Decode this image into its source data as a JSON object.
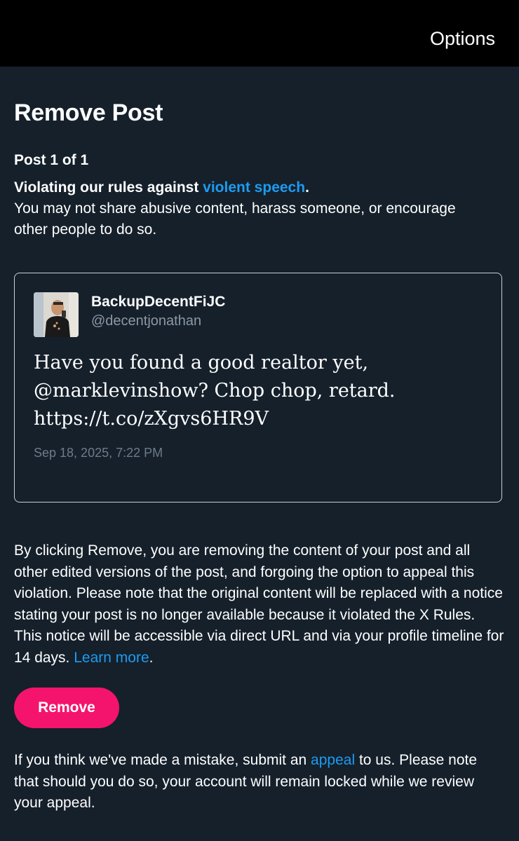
{
  "header": {
    "options_label": "Options"
  },
  "page": {
    "title": "Remove Post",
    "post_count": "Post 1 of 1"
  },
  "violation": {
    "headline_prefix": "Violating our rules against ",
    "rule_link": "violent speech",
    "headline_suffix": ".",
    "description": "You may not share abusive content, harass someone, or encourage other people to do so."
  },
  "tweet": {
    "display_name": "BackupDecentFiJC",
    "handle": "@decentjonathan",
    "text": "Have you found a good realtor yet, @marklevinshow? Chop chop, retard. https://t.co/zXgvs6HR9V",
    "date": "Sep 18, 2025, 7:22 PM"
  },
  "explanation": {
    "text": "By clicking Remove, you are removing the content of your post and all other edited versions of the post, and forgoing the option to appeal this violation. Please note that the original content will be replaced with a notice stating your post is no longer available because it violated the X Rules. This notice will be accessible via direct URL and via your profile timeline for 14 days. ",
    "learn_more": "Learn more",
    "suffix": "."
  },
  "actions": {
    "remove_label": "Remove"
  },
  "appeal": {
    "prefix": "If you think we've made a mistake, submit an ",
    "link": "appeal",
    "suffix": " to us. Please note that should you do so, your account will remain locked while we review your appeal."
  },
  "colors": {
    "background": "#15202b",
    "topbar": "#000000",
    "link": "#1d9bf0",
    "remove_button": "#f4146d",
    "muted_text": "#8b98a5"
  }
}
